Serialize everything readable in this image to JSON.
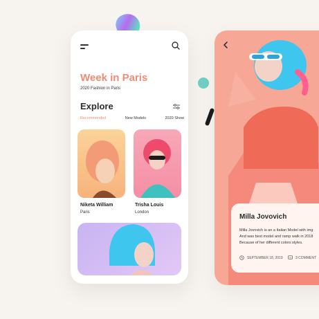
{
  "colors": {
    "accent": "#f28a74",
    "background": "#f7f3ef",
    "detail_bg": "#f7a796"
  },
  "home": {
    "title": "Week in Paris",
    "subtitle": "2020 Fashion in Paris",
    "section": "Explore",
    "tabs": [
      "Recommended",
      "New Models",
      "2020 Show"
    ],
    "cards": [
      {
        "name": "Niketa William",
        "city": "Paris"
      },
      {
        "name": "Trisha Louis",
        "city": "London"
      }
    ]
  },
  "detail": {
    "name": "Milla Jovovich",
    "description": [
      "Milla Jovovich is an a Italian Model with img",
      "And was best model and ramp walk in 2018",
      "Because of her different colors styles."
    ],
    "date": "SEPTEMBER 18, 2019",
    "comments": "3 COMMENT"
  }
}
